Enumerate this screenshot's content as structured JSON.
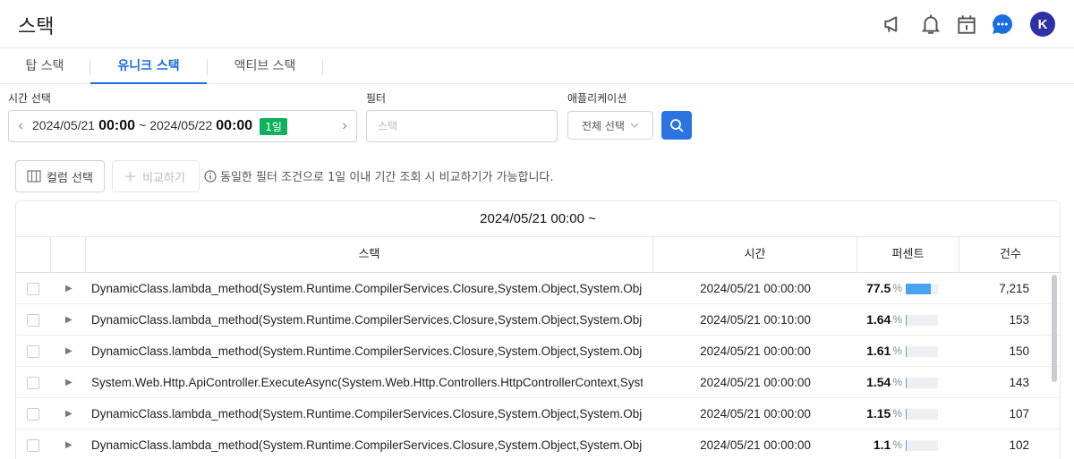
{
  "header": {
    "title": "스택",
    "icons": [
      "megaphone-icon",
      "bell-icon",
      "calendar-icon",
      "chat-icon"
    ],
    "avatar": "K",
    "colors": {
      "chat": "#1a6fe0",
      "avatar": "#2f2fa8"
    }
  },
  "tabs": [
    {
      "label": "탑 스택",
      "active": false
    },
    {
      "label": "유니크 스택",
      "active": true
    },
    {
      "label": "액티브 스택",
      "active": false
    }
  ],
  "filters": {
    "time_label": "시간 선택",
    "start_date": "2024/05/21",
    "start_time": "00:00",
    "separator": "~",
    "end_date": "2024/05/22",
    "end_time": "00:00",
    "range_badge": "1일",
    "filter_label": "필터",
    "filter_placeholder": "스택",
    "app_label": "애플리케이션",
    "app_select": "전체 선택"
  },
  "toolbar": {
    "column_select": "컬럼 선택",
    "compare": "비교하기",
    "info": "동일한 필터 조건으로 1일 이내 기간 조회 시 비교하기가 가능합니다."
  },
  "table": {
    "title": "2024/05/21 00:00 ~",
    "headers": {
      "stack": "스택",
      "time": "시간",
      "percent": "퍼센트",
      "count": "건수"
    },
    "percent_unit": "%",
    "rows": [
      {
        "stack": "DynamicClass.lambda_method(System.Runtime.CompilerServices.Closure,System.Object,System.Object[])",
        "time": "2024/05/21 00:00:00",
        "percent": "77.5",
        "count": "7,215"
      },
      {
        "stack": "DynamicClass.lambda_method(System.Runtime.CompilerServices.Closure,System.Object,System.Object[])",
        "time": "2024/05/21 00:10:00",
        "percent": "1.64",
        "count": "153"
      },
      {
        "stack": "DynamicClass.lambda_method(System.Runtime.CompilerServices.Closure,System.Object,System.Object[])",
        "time": "2024/05/21 00:00:00",
        "percent": "1.61",
        "count": "150"
      },
      {
        "stack": "System.Web.Http.ApiController.ExecuteAsync(System.Web.Http.Controllers.HttpControllerContext,System.Threading.CancellationToken)",
        "time": "2024/05/21 00:00:00",
        "percent": "1.54",
        "count": "143"
      },
      {
        "stack": "DynamicClass.lambda_method(System.Runtime.CompilerServices.Closure,System.Object,System.Object[])",
        "time": "2024/05/21 00:00:00",
        "percent": "1.15",
        "count": "107"
      },
      {
        "stack": "DynamicClass.lambda_method(System.Runtime.CompilerServices.Closure,System.Object,System.Object[])",
        "time": "2024/05/21 00:00:00",
        "percent": "1.1",
        "count": "102"
      }
    ]
  }
}
